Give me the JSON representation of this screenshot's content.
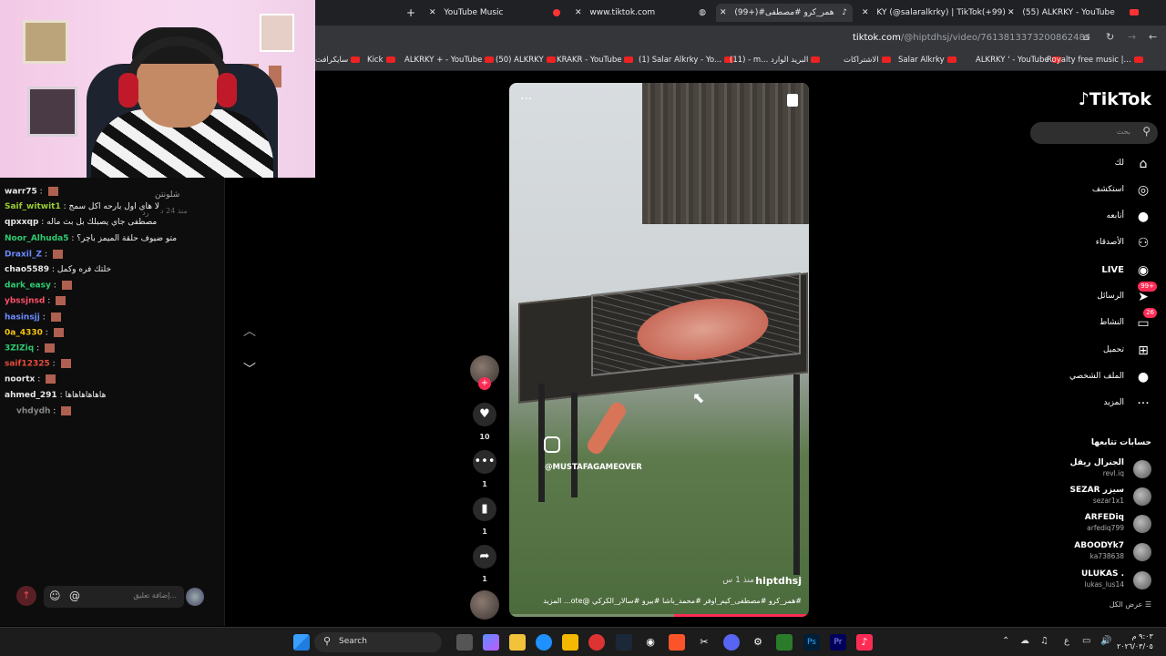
{
  "tabs": [
    {
      "label": "YouTube Music",
      "active": false
    },
    {
      "label": "www.tiktok.com",
      "active": false
    },
    {
      "label": "(99+)#همر_كرو #مصطفى",
      "active": true
    },
    {
      "label": "KY (@salaralkrky) | TikTok(+99)",
      "active": false
    },
    {
      "label": "(55) ALKRKY - YouTube",
      "active": false
    }
  ],
  "address": {
    "domain": "tiktok.com",
    "path": "/@hiptdhsj/video/7613813373200862484"
  },
  "bookmarks": [
    "سايكرافت",
    "Kick",
    "ALKRKY + - YouTube",
    "(50) ALKRKY",
    "KRAKR - YouTube",
    "(1) Salar Alkrky - Yo...",
    "(11) - m... البريد الوارد",
    "الاشتراكات",
    "Salar Alkrky",
    "ALKRKY ' - YouTube",
    "Royalty free music |..."
  ],
  "chat": [
    {
      "user": "warr75",
      "msg": "",
      "emote": true,
      "color": "#e7e7e7"
    },
    {
      "user": "Saif_witwit1",
      "msg": "لا هاي اول بارحه اكل سمج",
      "emote": false,
      "color": "#9acd32"
    },
    {
      "user": "qpxxqp",
      "msg": "مصطفى جاي يصبلك بل بث ماله",
      "emote": false,
      "color": "#e7e7e7"
    },
    {
      "user": "Noor_Alhuda5",
      "msg": "متو ضيوف حلقة الميمز باچر؟",
      "emote": false,
      "color": "#2ecc71"
    },
    {
      "user": "Draxil_Z",
      "msg": "",
      "emote": true,
      "color": "#6b8cff"
    },
    {
      "user": "chao5589",
      "msg": "خلتك فره وكمل",
      "emote": false,
      "color": "#e7e7e7"
    },
    {
      "user": "dark_easy",
      "msg": "",
      "emote": true,
      "color": "#2ecc71"
    },
    {
      "user": "ybssjnsd",
      "msg": "",
      "emote": true,
      "color": "#ff4f6a"
    },
    {
      "user": "hasinsjj",
      "msg": "",
      "emote": true,
      "color": "#6b8cff"
    },
    {
      "user": "0a_4330",
      "msg": "",
      "emote": true,
      "color": "#f1c40f"
    },
    {
      "user": "3ZIZiq",
      "msg": "",
      "emote": true,
      "color": "#2ecc71"
    },
    {
      "user": "saif12325",
      "msg": "",
      "emote": true,
      "color": "#e74c3c"
    },
    {
      "user": "noortx",
      "msg": "",
      "emote": true,
      "color": "#e7e7e7"
    },
    {
      "user": "ahmed_291",
      "msg": "هاهاهاهاهاها",
      "emote": false,
      "color": "#e7e7e7"
    },
    {
      "user": "vhdydh",
      "msg": "",
      "emote": true,
      "color": "#888888"
    }
  ],
  "comment_fragments": [
    "شلونتن",
    "منذ 24 د",
    "رد"
  ],
  "video": {
    "watermark": "@MUSTAFAGAMEOVER",
    "author": "hiptdhsj",
    "time": "منذ 1 س",
    "caption": "#همر_كرو #مصطفى_كيم_اوفر #محمد_باشا #بيرو #سالار_الكركي @ote...  المزيد",
    "progress": 0.45
  },
  "actions": {
    "likes": "10",
    "comments": "1",
    "saves": "1",
    "shares": "1"
  },
  "tiktok": {
    "logo": "TikTok",
    "search_placeholder": "بحث",
    "nav": [
      {
        "label": "لك",
        "icon": "⌂",
        "badge": ""
      },
      {
        "label": "استكشف",
        "icon": "◎",
        "badge": ""
      },
      {
        "label": "أتابعه",
        "icon": "●",
        "badge": ""
      },
      {
        "label": "الأصدقاء",
        "icon": "⚇",
        "badge": ""
      },
      {
        "label": "LIVE",
        "icon": "◉",
        "badge": ""
      },
      {
        "label": "الرسائل",
        "icon": "➤",
        "badge": "99+"
      },
      {
        "label": "النشاط",
        "icon": "▭",
        "badge": "26"
      },
      {
        "label": "تحميل",
        "icon": "⊞",
        "badge": ""
      },
      {
        "label": "الملف الشخصي",
        "icon": "●",
        "badge": ""
      },
      {
        "label": "المزيد",
        "icon": "···",
        "badge": ""
      }
    ],
    "following_title": "حسابات تتابعها",
    "following": [
      {
        "name": "الجنرال ريقل",
        "id": "revl.iq"
      },
      {
        "name": "SEZAR سيزر",
        "id": "sezar1x1"
      },
      {
        "name": "ARFEDiq",
        "id": "arfediq799"
      },
      {
        "name": "ABOODYk7",
        "id": "ka738638"
      },
      {
        "name": "ULUKAS .",
        "id": "lukas_lus14"
      }
    ],
    "see_all": "عرض الكل"
  },
  "comment_input": {
    "placeholder": "إضافة تعليق..."
  },
  "taskbar": {
    "search_label": "Search",
    "time": "٩:٠٣ م",
    "date": "٢٠٢٦/٠٣/٠٥"
  },
  "colors": {
    "tiktok_red": "#fe2c55"
  }
}
